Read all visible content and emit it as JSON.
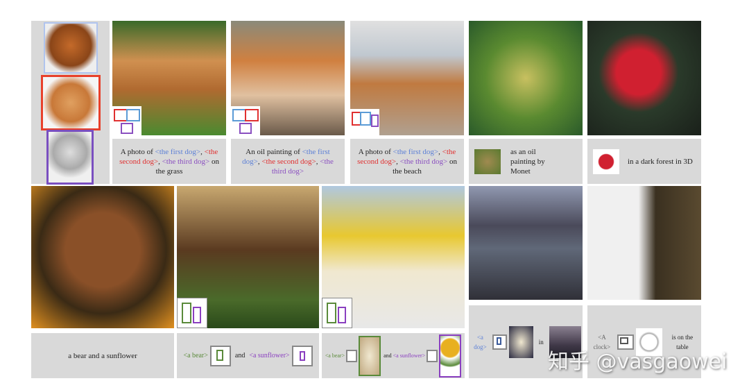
{
  "top_captions": {
    "c1": {
      "a": "A photo of ",
      "first": "<the first dog>",
      ", ": ", ",
      "second": "<the second dog>",
      "sep": ",  ",
      "third": "<the third dog>",
      "end": " on the grass"
    },
    "c2": {
      "a": "An oil painting of ",
      "first": "<the first dog>",
      "second": "<the second dog>",
      "third": "<the third dog>"
    },
    "c3": {
      "a": "A photo of ",
      "first": "<the first dog>",
      "second": "<the second dog>",
      "third": "<the third dog>",
      "end": " on the beach"
    },
    "c4": "as an oil painting by Monet",
    "c5": "in a dark forest in 3D"
  },
  "bottom_captions": {
    "c1": "a bear and  a sunflower",
    "c2": {
      "bear": "<a bear>",
      "and": "and",
      "sunflower": "<a sunflower>"
    },
    "c3": {
      "bear": "<a bear>",
      "and": "and",
      "sunflower": "<a sunflower>"
    },
    "c4": {
      "dog": "<a dog>",
      "in": "in"
    },
    "c5": {
      "clock": "<A clock>",
      "end": "is on the table"
    }
  },
  "watermark": "知乎 @vasgaowei",
  "colors": {
    "first": "#5b7fd6",
    "second": "#e03030",
    "third": "#8a4fc0",
    "bear": "#5a8a3a",
    "sunflower": "#8a3fc0",
    "cell": "#d9d9d9"
  }
}
